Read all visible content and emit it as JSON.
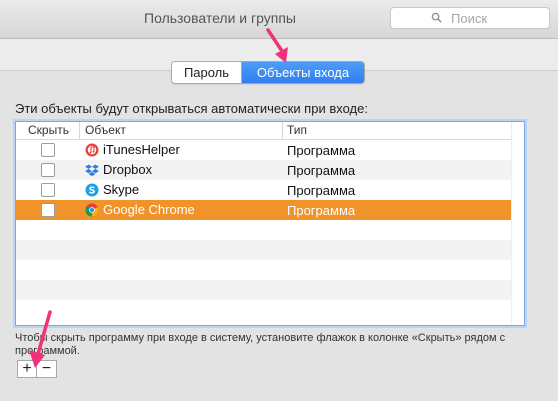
{
  "window": {
    "title": "Пользователи и группы"
  },
  "search": {
    "placeholder": "Поиск"
  },
  "tabs": [
    {
      "label": "Пароль",
      "selected": false
    },
    {
      "label": "Объекты входа",
      "selected": true
    }
  ],
  "intro_text": "Эти объекты будут открываться автоматически при входе:",
  "table": {
    "headers": {
      "hide": "Скрыть",
      "object": "Объект",
      "type": "Тип"
    },
    "rows": [
      {
        "name": "iTunesHelper",
        "type": "Программа",
        "icon": "itunes-icon",
        "selected": false
      },
      {
        "name": "Dropbox",
        "type": "Программа",
        "icon": "dropbox-icon",
        "selected": false
      },
      {
        "name": "Skype",
        "type": "Программа",
        "icon": "skype-icon",
        "selected": false
      },
      {
        "name": "Google Chrome",
        "type": "Программа",
        "icon": "chrome-icon",
        "selected": true
      }
    ]
  },
  "hint_text": "Чтобы скрыть программу при входе в систему, установите флажок в колонке «Скрыть» рядом с программой.",
  "buttons": {
    "add": "+",
    "remove": "−"
  },
  "colors": {
    "accent": "#2f7ff0",
    "selection": "#f0932b",
    "annotation_arrow": "#f0327a"
  }
}
